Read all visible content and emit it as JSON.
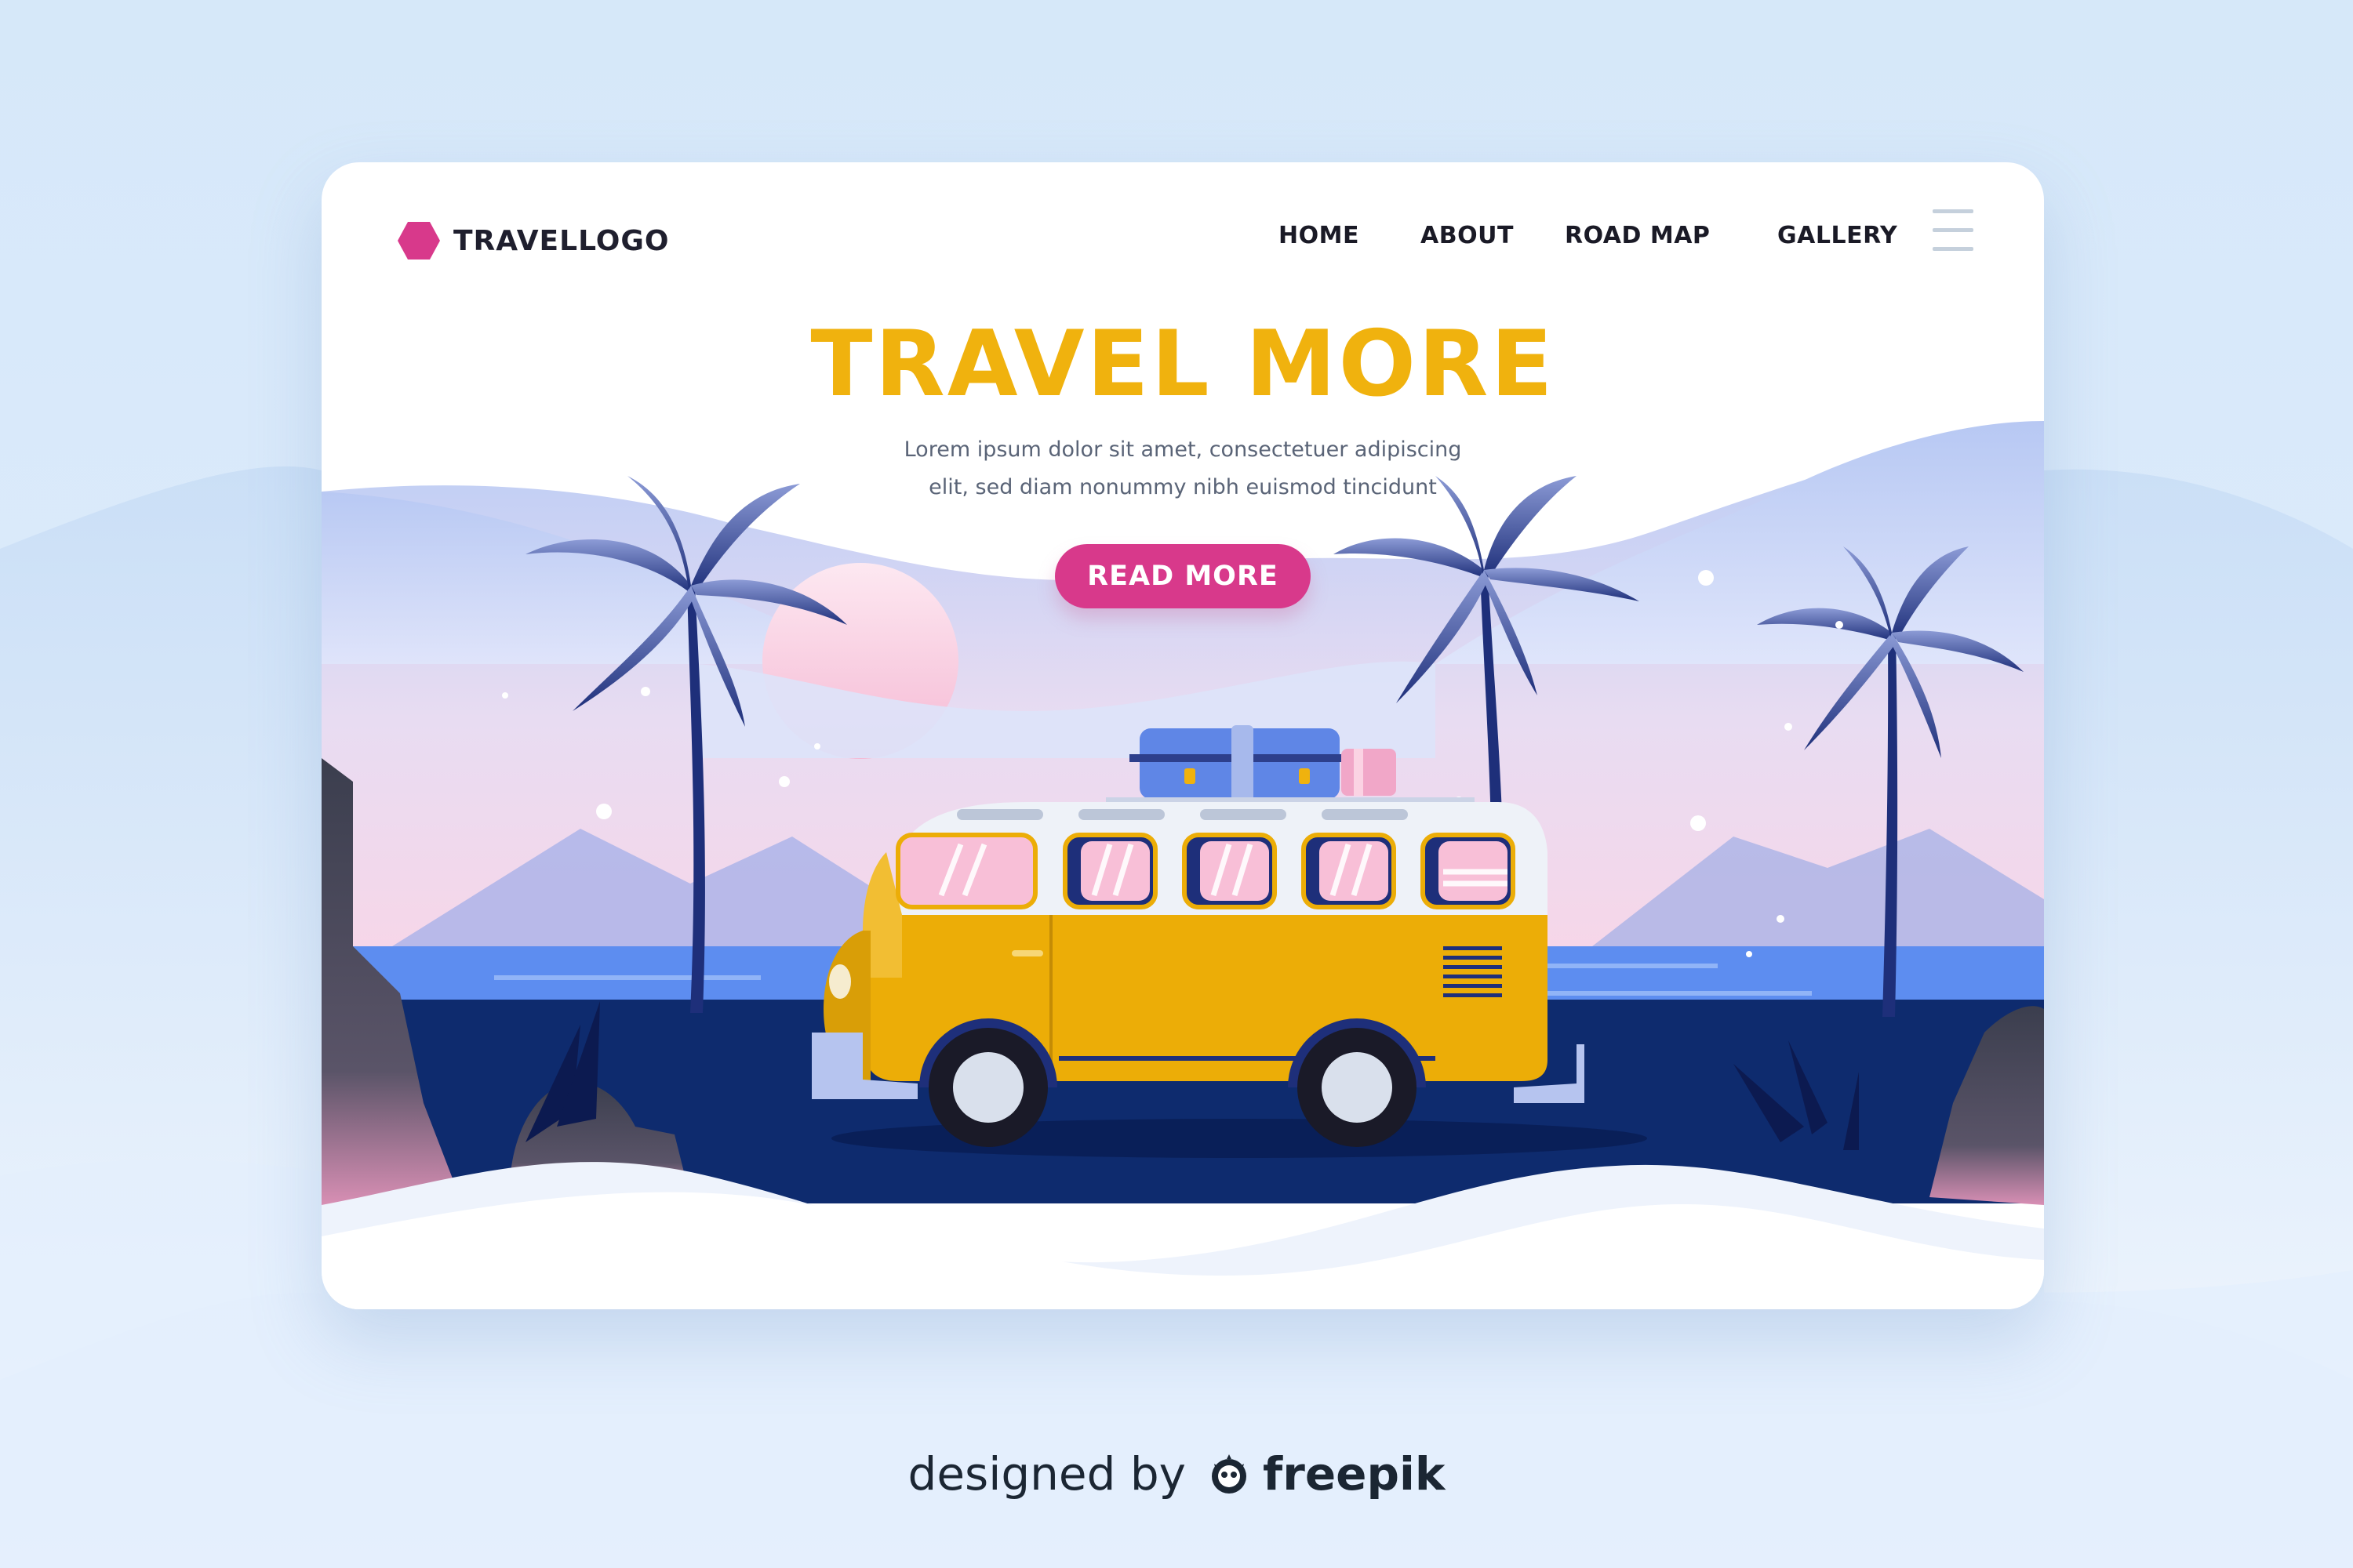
{
  "logo": {
    "text": "TRAVELLOGO",
    "icon": "hexagon-icon",
    "color": "#d8398b"
  },
  "nav": {
    "items": [
      {
        "label": "HOME"
      },
      {
        "label": "ABOUT"
      },
      {
        "label": "ROAD MAP"
      },
      {
        "label": "GALLERY"
      }
    ],
    "menu_icon": "hamburger-menu-icon"
  },
  "hero": {
    "title": "TRAVEL MORE",
    "description_line1": "Lorem ipsum dolor sit amet, consectetuer adipiscing",
    "description_line2": "elit, sed diam nonummy nibh euismod tincidunt",
    "button_label": "READ MORE"
  },
  "colors": {
    "accent": "#d8398b",
    "title": "#f0b20e",
    "van": "#ecad07",
    "road": "#0e2b6e",
    "sea": "#5d8df0"
  },
  "credit": {
    "prefix": "designed by",
    "brand": "freepik",
    "icon": "freepik-mascot-icon"
  }
}
